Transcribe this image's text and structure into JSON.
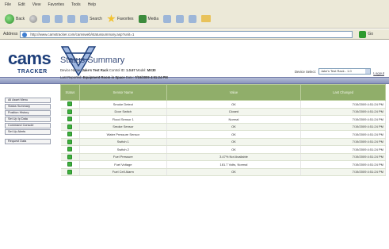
{
  "browser": {
    "menu": [
      "File",
      "Edit",
      "View",
      "Favorites",
      "Tools",
      "Help"
    ],
    "toolbar": {
      "back_label": "Back",
      "search_label": "Search",
      "favorites_label": "Favorites",
      "media_label": "Media"
    },
    "address_label": "Address",
    "address_value": "http://www.camstracker.com/camsweb/statussummary.asp?unit=1",
    "go_label": "Go"
  },
  "header": {
    "logo_text": "cams",
    "logo_sub": "TRACKER",
    "logout_label": "Logout",
    "brand_color": "#1e3f7a",
    "banner_color": "#8b95bd"
  },
  "sidebar": {
    "items": [
      "All Asset Menu",
      "Status Summary",
      "Position History",
      "Set Up Ip Data",
      "Command Console",
      "Set Up Alerts"
    ],
    "extra": "Request Data"
  },
  "main": {
    "title": "Status Summary",
    "info1": {
      "device_label": "Device Name:",
      "device_value": "Jake's Test Rack",
      "control_label": "Control ID:",
      "control_value": "1.0.67",
      "model_label": "Model:",
      "model_value": "MX30"
    },
    "info2": {
      "reported_label": "Last Reported:",
      "reported_value": "Equipment Room in Space",
      "date_label": "Date:",
      "date_value": "7/19/2009 4:51:24 PM"
    },
    "selector_label": "Device Select:",
    "selector_value": "Jake's Test Rack - 1.0",
    "table": {
      "columns": [
        "Status",
        "Sensor Name",
        "Value",
        "Last Changed"
      ],
      "status_color": "#3db13d",
      "header_color": "#90ae6a",
      "rows": [
        {
          "name": "Smoke Detect",
          "value": "OK",
          "ts": "7/19/2009 4:51:24 PM"
        },
        {
          "name": "Door Switch",
          "value": "Closed",
          "ts": "7/19/2009 4:51:24 PM"
        },
        {
          "name": "Flood Sensor 1",
          "value": "Normal",
          "ts": "7/19/2009 4:51:24 PM"
        },
        {
          "name": "Smoke Sensor",
          "value": "OK",
          "ts": "7/19/2009 4:51:24 PM"
        },
        {
          "name": "Water Pressure Sensor",
          "value": "OK",
          "ts": "7/19/2009 4:51:24 PM"
        },
        {
          "name": "Switch 1",
          "value": "OK",
          "ts": "7/19/2009 4:51:24 PM"
        },
        {
          "name": "Switch 2",
          "value": "OK",
          "ts": "7/19/2009 4:51:24 PM"
        },
        {
          "name": "Fuel Pressure",
          "value": "3.47% Not Available",
          "ts": "7/19/2009 4:51:24 PM"
        },
        {
          "name": "Fuel Voltage",
          "value": "181.7 Volts, Normal",
          "ts": "7/19/2009 4:51:24 PM"
        },
        {
          "name": "Fuel Cell Alarm",
          "value": "OK",
          "ts": "7/19/2009 4:51:24 PM"
        }
      ]
    }
  }
}
